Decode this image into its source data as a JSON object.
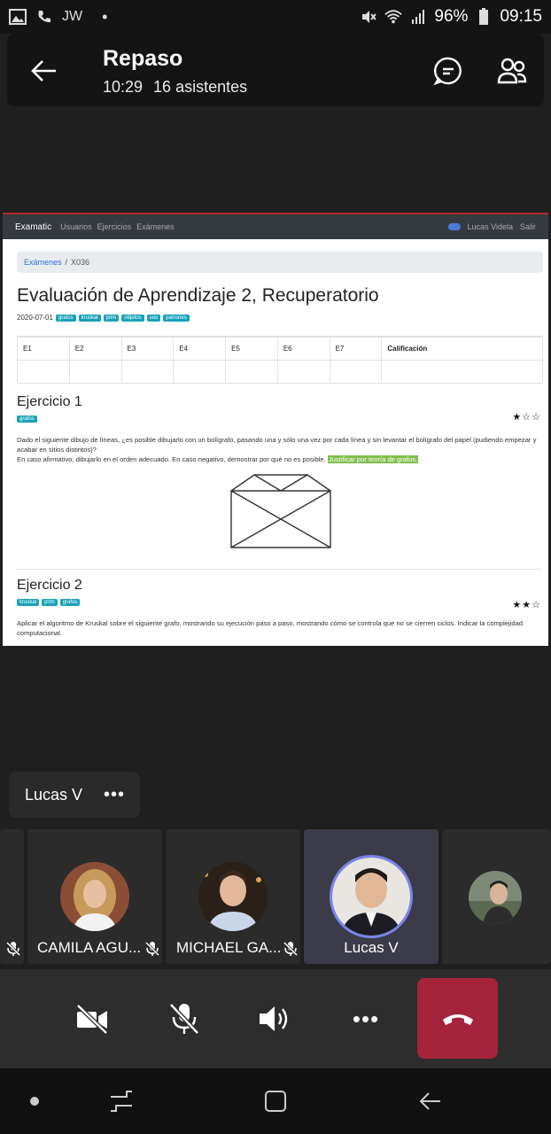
{
  "status_bar": {
    "carrier": "JW",
    "dot": "•",
    "battery": "96%",
    "time": "09:15"
  },
  "header": {
    "title": "Repaso",
    "elapsed": "10:29",
    "attendees": "16 asistentes"
  },
  "shared_screen": {
    "nav": {
      "brand": "Examatic",
      "links": [
        "Usuarios",
        "Ejercicios",
        "Exámenes"
      ],
      "user": "Lucas Videla",
      "logout": "Salir"
    },
    "breadcrumb": {
      "root": "Exámenes",
      "separator": "/",
      "current": "X036"
    },
    "title": "Evaluación de Aprendizaje 2, Recuperatorio",
    "date": "2020-07-01",
    "tags": [
      "grafos",
      "kruskal",
      "prim",
      "objetos",
      "uso",
      "patrones"
    ],
    "grade_table": {
      "headers": [
        "E1",
        "E2",
        "E3",
        "E4",
        "E5",
        "E6",
        "E7",
        "Calificación"
      ]
    },
    "exercise1": {
      "title": "Ejercicio 1",
      "tags": [
        "grafos"
      ],
      "stars": "★☆☆",
      "line1": "Dado el siguiente dibujo de líneas, ¿es posible dibujarlo con un bolígrafo, pasando una y sólo una vez por cada línea y sin levantar el bolígrafo del papel (pudiendo empezar y acabar en sitios distintos)?",
      "line2": "En caso afirmativo, dibujarlo en el orden adecuado. En caso negativo, demostrar por qué no es posible.",
      "highlight": "Justificar por teoría de grafos."
    },
    "exercise2": {
      "title": "Ejercicio 2",
      "tags": [
        "kruskal",
        "prim",
        "grafos"
      ],
      "stars": "★★☆",
      "text": "Aplicar el algoritmo de Kruskal sobre el siguiente grafo, mostrando su ejecución paso a paso, mostrando cómo se controla que no se cierren ciclos. Indicar la complejidad computacional."
    }
  },
  "presenter_pill": {
    "name": "Lucas V",
    "more": "•••"
  },
  "participants": [
    {
      "name": "CAMILA AGU...",
      "muted": true,
      "active": false
    },
    {
      "name": "MICHAEL GA...",
      "muted": true,
      "active": false
    },
    {
      "name": "Lucas V",
      "muted": false,
      "active": true
    }
  ],
  "controls": {
    "more": "•••"
  },
  "colors": {
    "hangup": "#a4243b",
    "background": "#1f1f1f",
    "accent_ring": "#7b83eb"
  }
}
